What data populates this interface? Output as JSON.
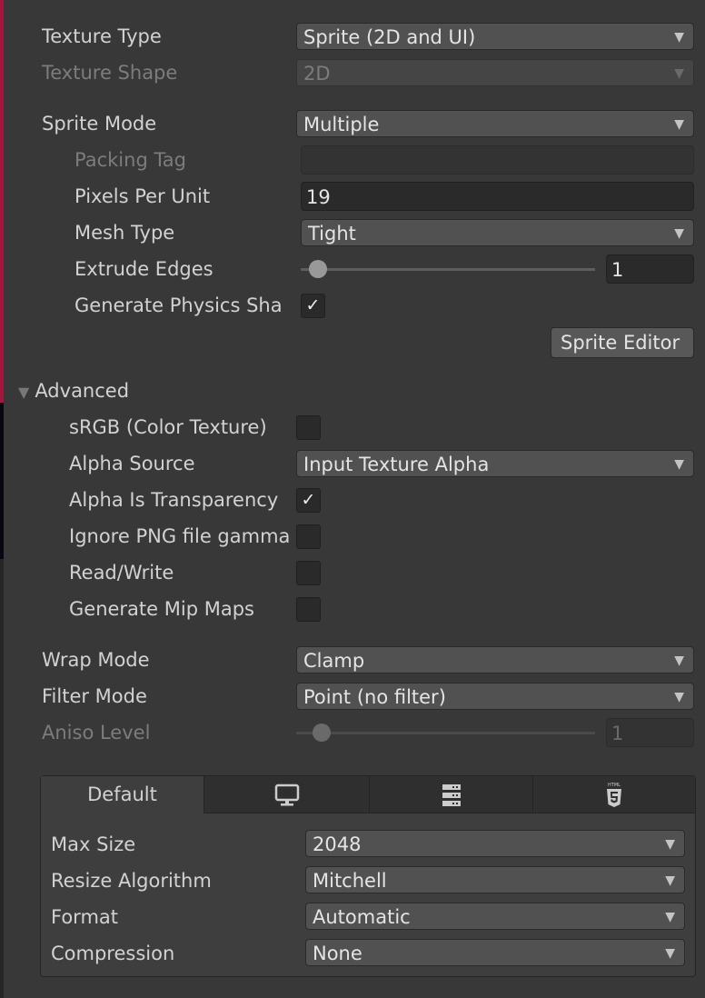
{
  "texture_type": {
    "label": "Texture Type",
    "value": "Sprite (2D and UI)"
  },
  "texture_shape": {
    "label": "Texture Shape",
    "value": "2D"
  },
  "sprite_mode": {
    "label": "Sprite Mode",
    "value": "Multiple"
  },
  "packing_tag": {
    "label": "Packing Tag",
    "value": ""
  },
  "pixels_per_unit": {
    "label": "Pixels Per Unit",
    "value": "19"
  },
  "mesh_type": {
    "label": "Mesh Type",
    "value": "Tight"
  },
  "extrude_edges": {
    "label": "Extrude Edges",
    "value": "1",
    "slider_min": 0,
    "slider_max": 32
  },
  "generate_physics_shape": {
    "label": "Generate Physics Sha",
    "checked": true
  },
  "sprite_editor_button": "Sprite Editor",
  "advanced": {
    "label": "Advanced",
    "expanded": true,
    "srgb": {
      "label": "sRGB (Color Texture)",
      "checked": false
    },
    "alpha_source": {
      "label": "Alpha Source",
      "value": "Input Texture Alpha"
    },
    "alpha_is_transparency": {
      "label": "Alpha Is Transparency",
      "checked": true
    },
    "ignore_png_gamma": {
      "label": "Ignore PNG file gamma",
      "checked": false
    },
    "read_write": {
      "label": "Read/Write",
      "checked": false
    },
    "generate_mip_maps": {
      "label": "Generate Mip Maps",
      "checked": false
    }
  },
  "wrap_mode": {
    "label": "Wrap Mode",
    "value": "Clamp"
  },
  "filter_mode": {
    "label": "Filter Mode",
    "value": "Point (no filter)"
  },
  "aniso_level": {
    "label": "Aniso Level",
    "value": "1",
    "slider_min": 0,
    "slider_max": 16
  },
  "platform_tabs": [
    {
      "label": "Default",
      "icon": null,
      "active": true
    },
    {
      "label": "",
      "icon": "monitor-icon"
    },
    {
      "label": "",
      "icon": "server-icon"
    },
    {
      "label": "",
      "icon": "html5-icon",
      "icon_text": "HTML"
    }
  ],
  "platform_settings": {
    "max_size": {
      "label": "Max Size",
      "value": "2048"
    },
    "resize_algorithm": {
      "label": "Resize Algorithm",
      "value": "Mitchell"
    },
    "format": {
      "label": "Format",
      "value": "Automatic"
    },
    "compression": {
      "label": "Compression",
      "value": "None"
    }
  },
  "colors": {
    "background": "#383838",
    "accent_stripe": "#a3173e"
  }
}
